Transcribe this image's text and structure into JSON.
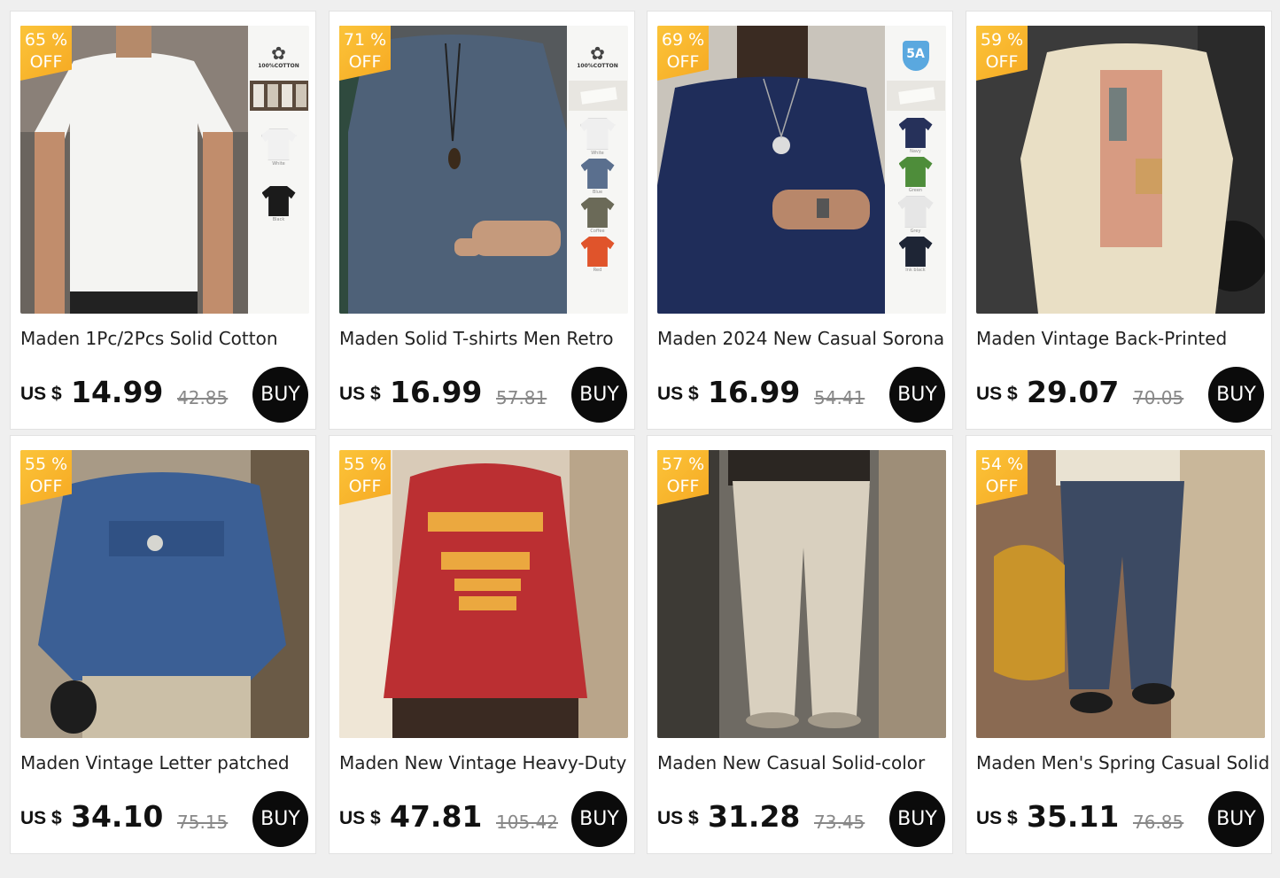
{
  "products": [
    {
      "discount_pct": "65 %",
      "off_label": "OFF",
      "title": "Maden 1Pc/2Pcs Solid Cotton",
      "currency": "US $",
      "price": "14.99",
      "original_price": "42.85",
      "buy_label": "BUY",
      "cert_text": "100%COTTON",
      "swatches": [
        {
          "label": "White",
          "color": "#f1f1f1"
        },
        {
          "label": "Black",
          "color": "#1b1b1b"
        }
      ]
    },
    {
      "discount_pct": "71 %",
      "off_label": "OFF",
      "title": "Maden Solid T-shirts Men Retro",
      "currency": "US $",
      "price": "16.99",
      "original_price": "57.81",
      "buy_label": "BUY",
      "cert_text": "100%COTTON",
      "swatches": [
        {
          "label": "White",
          "color": "#efefef"
        },
        {
          "label": "Blue",
          "color": "#5a6f8e"
        },
        {
          "label": "Coffee",
          "color": "#6b6a58"
        },
        {
          "label": "Red",
          "color": "#e0542b"
        }
      ]
    },
    {
      "discount_pct": "69 %",
      "off_label": "OFF",
      "title": "Maden 2024 New Casual Sorona",
      "currency": "US $",
      "price": "16.99",
      "original_price": "54.41",
      "buy_label": "BUY",
      "cert_text": "5A",
      "swatches": [
        {
          "label": "Navy",
          "color": "#26315a"
        },
        {
          "label": "Green",
          "color": "#4e8d3a"
        },
        {
          "label": "Grey",
          "color": "#e6e6e6"
        },
        {
          "label": "Ink black",
          "color": "#1e2535"
        }
      ]
    },
    {
      "discount_pct": "59 %",
      "off_label": "OFF",
      "title": "Maden Vintage Back-Printed",
      "currency": "US $",
      "price": "29.07",
      "original_price": "70.05",
      "buy_label": "BUY"
    },
    {
      "discount_pct": "55 %",
      "off_label": "OFF",
      "title": "Maden Vintage Letter patched",
      "currency": "US $",
      "price": "34.10",
      "original_price": "75.15",
      "buy_label": "BUY"
    },
    {
      "discount_pct": "55 %",
      "off_label": "OFF",
      "title": "Maden New Vintage Heavy-Duty",
      "currency": "US $",
      "price": "47.81",
      "original_price": "105.42",
      "buy_label": "BUY"
    },
    {
      "discount_pct": "57 %",
      "off_label": "OFF",
      "title": "Maden New Casual Solid-color",
      "currency": "US $",
      "price": "31.28",
      "original_price": "73.45",
      "buy_label": "BUY"
    },
    {
      "discount_pct": "54 %",
      "off_label": "OFF",
      "title": "Maden Men's Spring Casual Solid",
      "currency": "US $",
      "price": "35.11",
      "original_price": "76.85",
      "buy_label": "BUY"
    }
  ]
}
